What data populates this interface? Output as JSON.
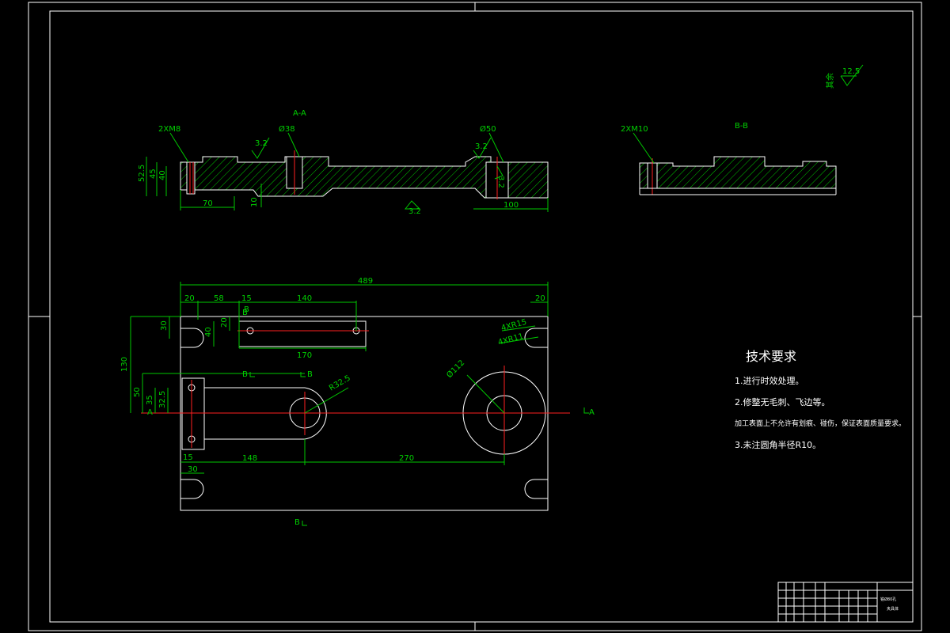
{
  "section_aa": {
    "title": "A-A",
    "labels": [
      "2XM8",
      "Ø38",
      "Ø50",
      "3.2",
      "3.2",
      "3.2",
      "3.2"
    ],
    "dims": [
      "52.5",
      "45",
      "40",
      "70",
      "10",
      "100"
    ]
  },
  "section_bb": {
    "title": "B-B",
    "labels": [
      "2XM10"
    ]
  },
  "roughness_note": {
    "symbol_value": "12.5",
    "label": "其余"
  },
  "plan_view": {
    "dims": [
      "489",
      "20",
      "58",
      "15",
      "140",
      "20",
      "30",
      "40",
      "20",
      "170",
      "130",
      "50",
      "35",
      "32.5",
      "R32.5",
      "Ø112",
      "15",
      "30",
      "148",
      "270"
    ],
    "labels": [
      "4XR15",
      "4XR11"
    ],
    "section_marks": [
      "B",
      "B",
      "B",
      "B",
      "B",
      "A",
      "A"
    ]
  },
  "tech_requirements": {
    "title": "技术要求",
    "items": [
      "1.进行时效处理。",
      "2.修整无毛刺、飞边等。",
      "加工表面上不允许有划痕、碰伤，保证表面质量要求。",
      "3.未注圆角半径R10。"
    ]
  },
  "title_block": {
    "name_line1": "铣Ø80孔",
    "name_line2": "夹具体"
  }
}
